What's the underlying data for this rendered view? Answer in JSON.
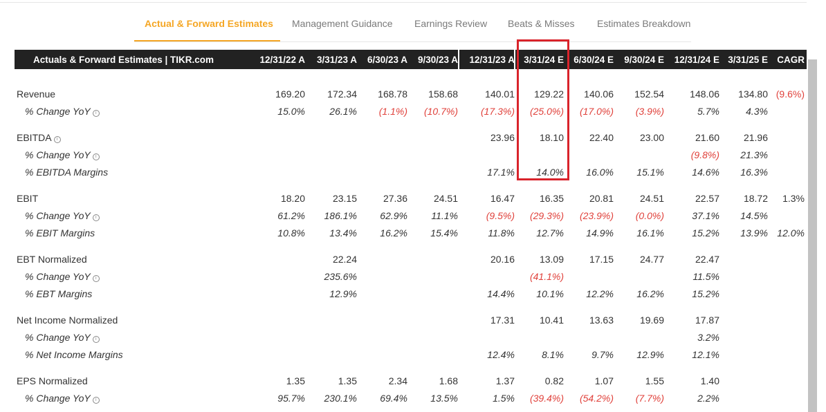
{
  "tabs": [
    {
      "label": "Actual & Forward Estimates",
      "active": true
    },
    {
      "label": "Management Guidance",
      "active": false
    },
    {
      "label": "Earnings Review",
      "active": false
    },
    {
      "label": "Beats & Misses",
      "active": false
    },
    {
      "label": "Estimates Breakdown",
      "active": false
    }
  ],
  "table": {
    "title": "Actuals & Forward Estimates | TIKR.com",
    "columns": [
      "12/31/22 A",
      "3/31/23 A",
      "6/30/23 A",
      "9/30/23 A",
      "12/31/23 A",
      "3/31/24 E",
      "6/30/24 E",
      "9/30/24 E",
      "12/31/24 E",
      "3/31/25 E",
      "CAGR"
    ],
    "rows": [
      {
        "label": "Revenue",
        "sub": false,
        "info": false,
        "values": [
          "169.20",
          "172.34",
          "168.78",
          "158.68",
          "140.01",
          "129.22",
          "140.06",
          "152.54",
          "148.06",
          "134.80",
          "(9.6%)"
        ]
      },
      {
        "label": "% Change YoY",
        "sub": true,
        "info": true,
        "values": [
          "15.0%",
          "26.1%",
          "(1.1%)",
          "(10.7%)",
          "(17.3%)",
          "(25.0%)",
          "(17.0%)",
          "(3.9%)",
          "5.7%",
          "4.3%",
          ""
        ]
      },
      {
        "label": "EBITDA",
        "sub": false,
        "info": true,
        "values": [
          "",
          "",
          "",
          "",
          "23.96",
          "18.10",
          "22.40",
          "23.00",
          "21.60",
          "21.96",
          ""
        ]
      },
      {
        "label": "% Change YoY",
        "sub": true,
        "info": true,
        "values": [
          "",
          "",
          "",
          "",
          "",
          "",
          "",
          "",
          "(9.8%)",
          "21.3%",
          ""
        ]
      },
      {
        "label": "% EBITDA Margins",
        "sub": true,
        "info": false,
        "values": [
          "",
          "",
          "",
          "",
          "17.1%",
          "14.0%",
          "16.0%",
          "15.1%",
          "14.6%",
          "16.3%",
          ""
        ]
      },
      {
        "label": "EBIT",
        "sub": false,
        "info": false,
        "values": [
          "18.20",
          "23.15",
          "27.36",
          "24.51",
          "16.47",
          "16.35",
          "20.81",
          "24.51",
          "22.57",
          "18.72",
          "1.3%"
        ]
      },
      {
        "label": "% Change YoY",
        "sub": true,
        "info": true,
        "values": [
          "61.2%",
          "186.1%",
          "62.9%",
          "11.1%",
          "(9.5%)",
          "(29.3%)",
          "(23.9%)",
          "(0.0%)",
          "37.1%",
          "14.5%",
          ""
        ]
      },
      {
        "label": "% EBIT Margins",
        "sub": true,
        "info": false,
        "values": [
          "10.8%",
          "13.4%",
          "16.2%",
          "15.4%",
          "11.8%",
          "12.7%",
          "14.9%",
          "16.1%",
          "15.2%",
          "13.9%",
          "12.0%"
        ]
      },
      {
        "label": "EBT Normalized",
        "sub": false,
        "info": false,
        "values": [
          "",
          "22.24",
          "",
          "",
          "20.16",
          "13.09",
          "17.15",
          "24.77",
          "22.47",
          "",
          ""
        ]
      },
      {
        "label": "% Change YoY",
        "sub": true,
        "info": true,
        "values": [
          "",
          "235.6%",
          "",
          "",
          "",
          "(41.1%)",
          "",
          "",
          "11.5%",
          "",
          ""
        ]
      },
      {
        "label": "% EBT Margins",
        "sub": true,
        "info": false,
        "values": [
          "",
          "12.9%",
          "",
          "",
          "14.4%",
          "10.1%",
          "12.2%",
          "16.2%",
          "15.2%",
          "",
          ""
        ]
      },
      {
        "label": "Net Income Normalized",
        "sub": false,
        "info": false,
        "values": [
          "",
          "",
          "",
          "",
          "17.31",
          "10.41",
          "13.63",
          "19.69",
          "17.87",
          "",
          ""
        ]
      },
      {
        "label": "% Change YoY",
        "sub": true,
        "info": true,
        "values": [
          "",
          "",
          "",
          "",
          "",
          "",
          "",
          "",
          "3.2%",
          "",
          ""
        ]
      },
      {
        "label": "% Net Income Margins",
        "sub": true,
        "info": false,
        "values": [
          "",
          "",
          "",
          "",
          "12.4%",
          "8.1%",
          "9.7%",
          "12.9%",
          "12.1%",
          "",
          ""
        ]
      },
      {
        "label": "EPS Normalized",
        "sub": false,
        "info": false,
        "values": [
          "1.35",
          "1.35",
          "2.34",
          "1.68",
          "1.37",
          "0.82",
          "1.07",
          "1.55",
          "1.40",
          "",
          ""
        ]
      },
      {
        "label": "% Change YoY",
        "sub": true,
        "info": true,
        "values": [
          "95.7%",
          "230.1%",
          "69.4%",
          "13.5%",
          "1.5%",
          "(39.4%)",
          "(54.2%)",
          "(7.7%)",
          "2.2%",
          "",
          ""
        ]
      }
    ]
  },
  "colors": {
    "accent": "#f5a623",
    "header_bg": "#222222",
    "negative": "#e0413b",
    "highlight_box": "#d9232b"
  }
}
